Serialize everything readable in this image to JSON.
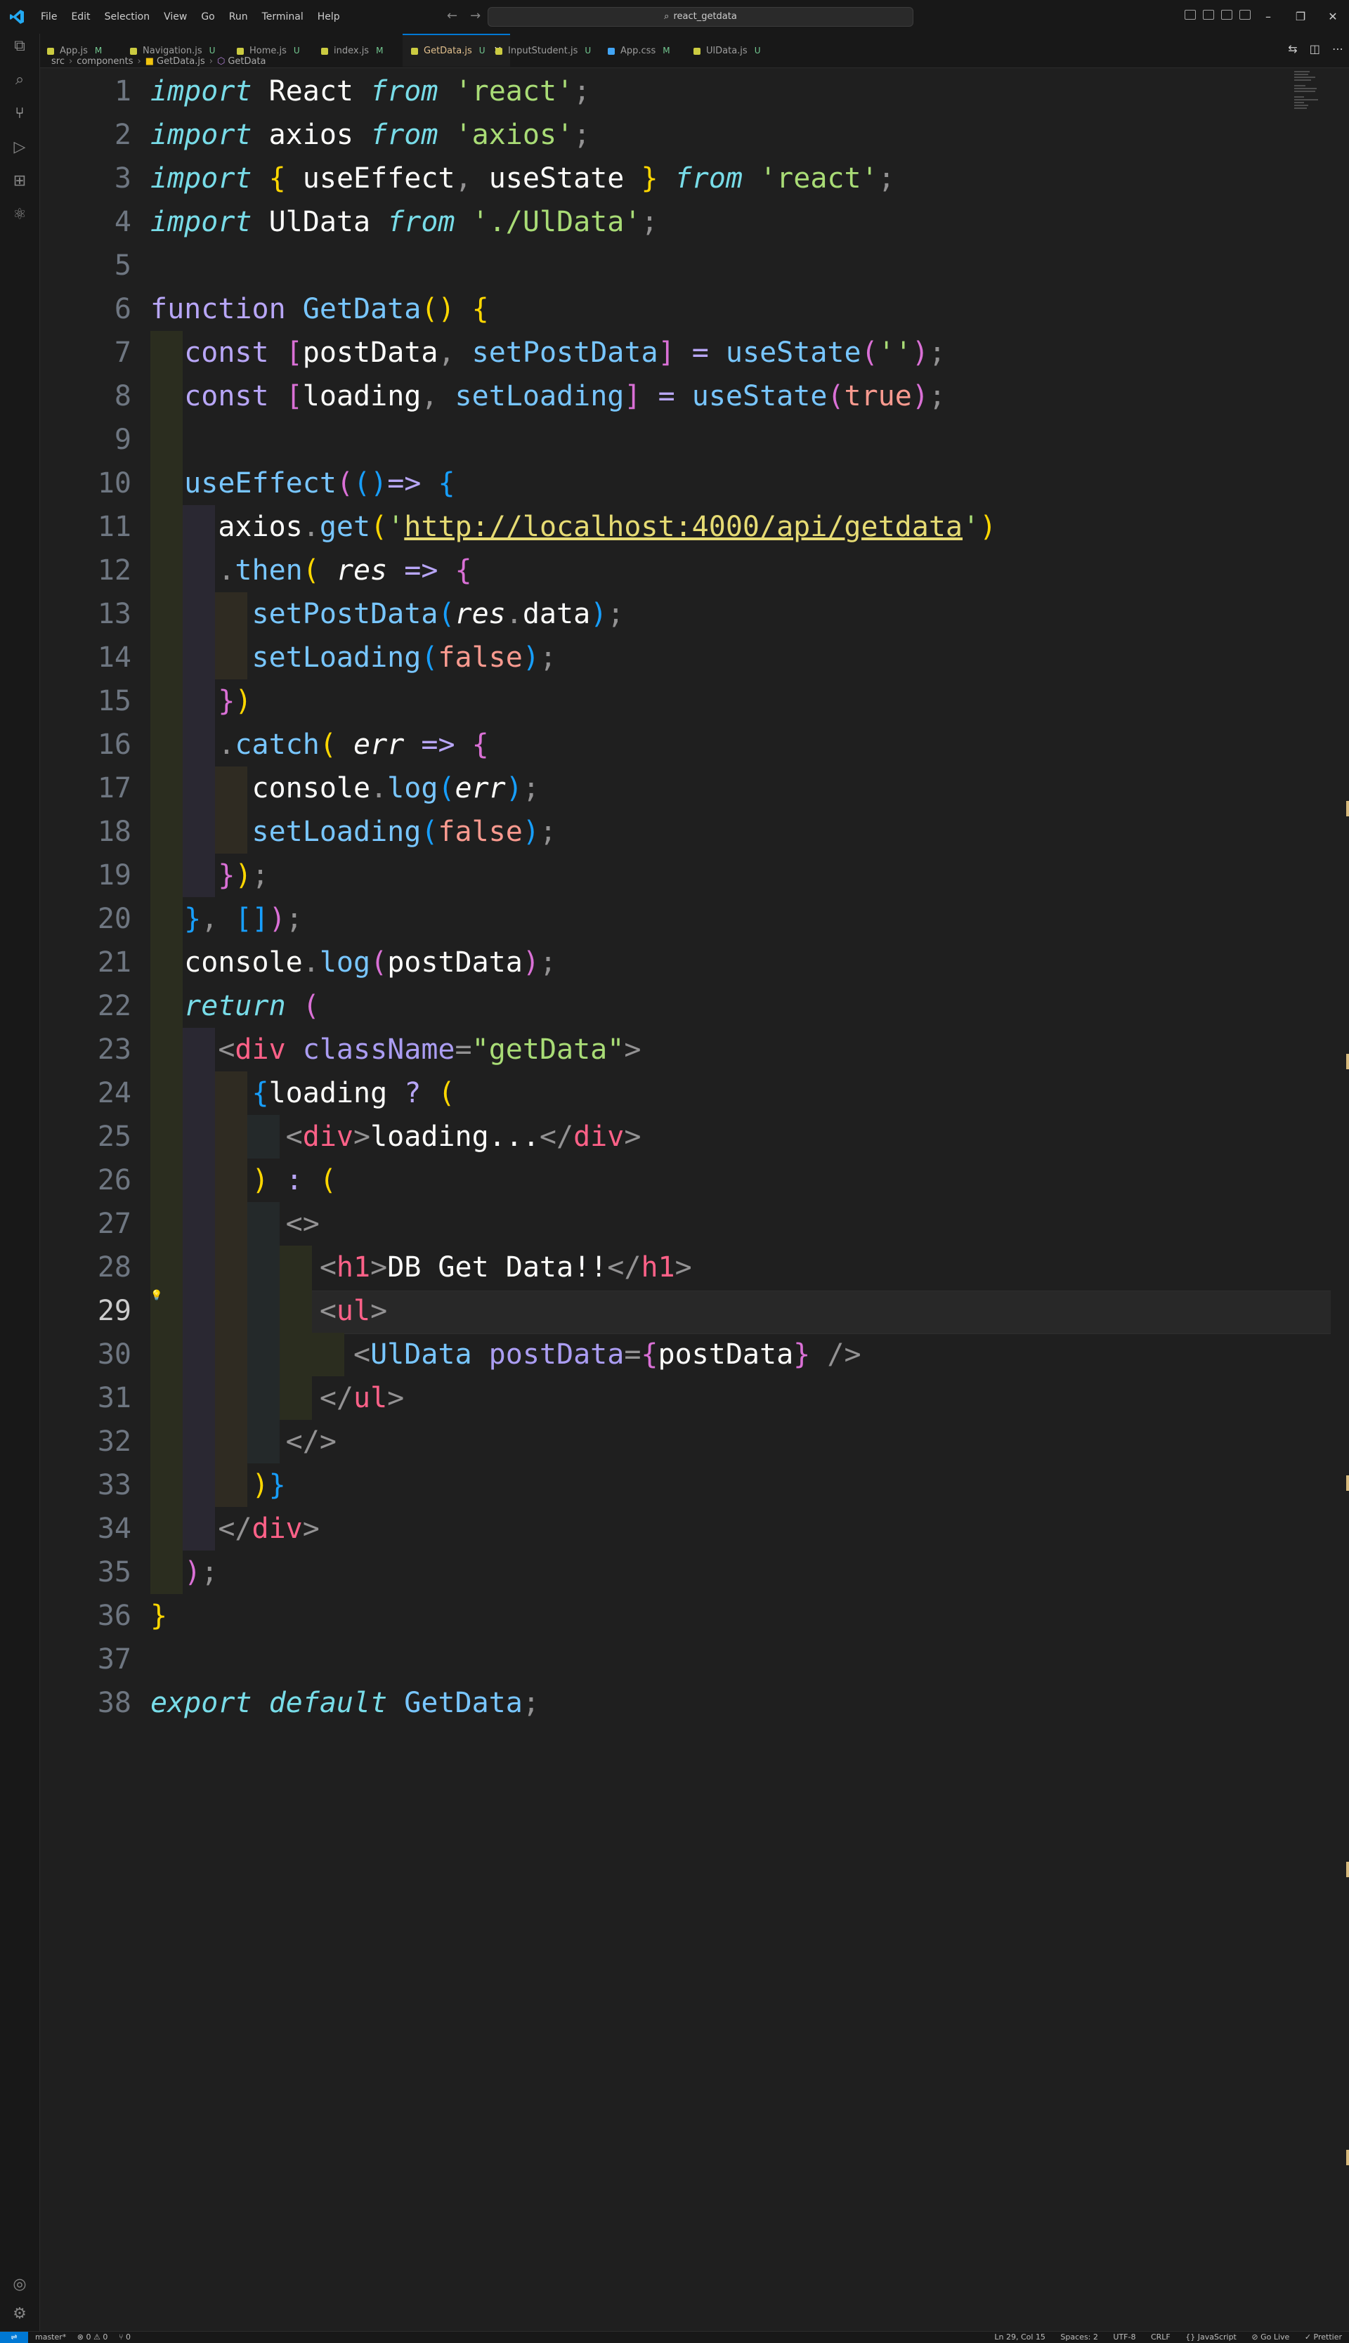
{
  "window": {
    "search_text": "react_getdata"
  },
  "menu": [
    "File",
    "Edit",
    "Selection",
    "View",
    "Go",
    "Run",
    "Terminal",
    "Help"
  ],
  "tabs": [
    {
      "label": "App.js",
      "mod": "M",
      "color": "#cbcb41"
    },
    {
      "label": "Navigation.js",
      "mod": "U",
      "color": "#cbcb41"
    },
    {
      "label": "Home.js",
      "mod": "U",
      "color": "#cbcb41"
    },
    {
      "label": "index.js",
      "mod": "M",
      "color": "#cbcb41"
    },
    {
      "label": "GetData.js",
      "mod": "U",
      "color": "#cbcb41",
      "active": true
    },
    {
      "label": "InputStudent.js",
      "mod": "U",
      "color": "#cbcb41"
    },
    {
      "label": "App.css",
      "mod": "M",
      "color": "#42a5f5"
    },
    {
      "label": "UlData.js",
      "mod": "U",
      "color": "#cbcb41"
    }
  ],
  "breadcrumb": {
    "p1": "src",
    "p2": "components",
    "p3": "GetData.js",
    "p4": "GetData"
  },
  "line_numbers": [
    "1",
    "2",
    "3",
    "4",
    "5",
    "6",
    "7",
    "8",
    "9",
    "10",
    "11",
    "12",
    "13",
    "14",
    "15",
    "16",
    "17",
    "18",
    "19",
    "20",
    "21",
    "22",
    "23",
    "24",
    "25",
    "26",
    "27",
    "28",
    "29",
    "30",
    "31",
    "32",
    "33",
    "34",
    "35",
    "36",
    "37",
    "38"
  ],
  "active_line": 29,
  "code": {
    "import": "import",
    "from": "from",
    "react_id": "React",
    "react_str": "'react'",
    "axios_id": "axios",
    "axios_str": "'axios'",
    "use_effect": "useEffect",
    "use_state": "useState",
    "uldata": "UlData",
    "uldata_path": "'./UlData'",
    "function_kw": "function",
    "getdata": "GetData",
    "const_kw": "const",
    "post_data": "postData",
    "set_post_data": "setPostData",
    "empty_str": "''",
    "loading": "loading",
    "set_loading": "setLoading",
    "true_kw": "true",
    "false_kw": "false",
    "get": "get",
    "url": "http://localhost:4000/api/getdata",
    "then": "then",
    "res": "res",
    "data": "data",
    "catch": "catch",
    "err": "err",
    "console": "console",
    "log": "log",
    "return_kw": "return",
    "div": "div",
    "class_name": "className",
    "class_val": "\"getData\"",
    "loading_text": "loading...",
    "h1": "h1",
    "h1_text": "DB Get Data!!",
    "ul": "ul",
    "export_kw": "export",
    "default_kw": "default"
  },
  "status": {
    "branch": "master*",
    "problems": "⊗ 0 ⚠ 0",
    "ports": "⑂ 0",
    "position": "Ln 29, Col 15",
    "spaces": "Spaces: 2",
    "encoding": "UTF-8",
    "eol": "CRLF",
    "language": "{} JavaScript",
    "golive": "⊘ Go Live",
    "prettier": "✓ Prettier"
  }
}
